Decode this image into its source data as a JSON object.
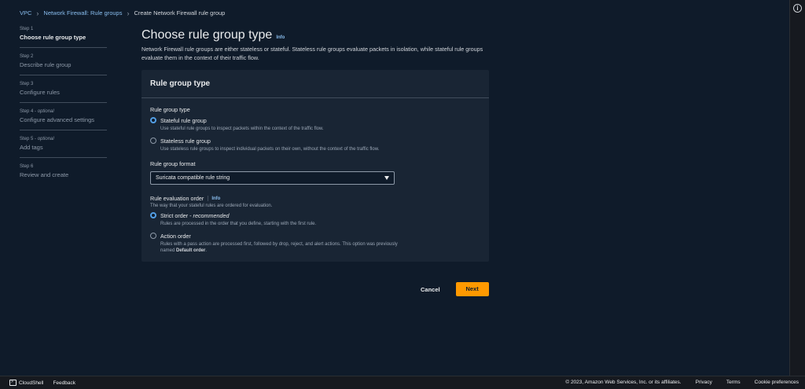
{
  "breadcrumb": {
    "items": [
      "VPC",
      "Network Firewall: Rule groups"
    ],
    "current": "Create Network Firewall rule group"
  },
  "steps": [
    {
      "num": "Step 1",
      "optional": "",
      "title": "Choose rule group type",
      "active": true
    },
    {
      "num": "Step 2",
      "optional": "",
      "title": "Describe rule group",
      "active": false
    },
    {
      "num": "Step 3",
      "optional": "",
      "title": "Configure rules",
      "active": false
    },
    {
      "num": "Step 4 - ",
      "optional": "optional",
      "title": "Configure advanced settings",
      "active": false
    },
    {
      "num": "Step 5 - ",
      "optional": "optional",
      "title": "Add tags",
      "active": false
    },
    {
      "num": "Step 6",
      "optional": "",
      "title": "Review and create",
      "active": false
    }
  ],
  "main": {
    "title": "Choose rule group type",
    "info": "Info",
    "description": "Network Firewall rule groups are either stateless or stateful. Stateless rule groups evaluate packets in isolation, while stateful rule groups evaluate them in the context of their traffic flow."
  },
  "container": {
    "header": "Rule group type",
    "type_label": "Rule group type",
    "type_options": [
      {
        "label": "Stateful rule group",
        "sub": "Use stateful rule groups to inspect packets within the context of the traffic flow.",
        "checked": true
      },
      {
        "label": "Stateless rule group",
        "sub": "Use stateless rule groups to inspect individual packets on their own, without the context of the traffic flow.",
        "checked": false
      }
    ],
    "format_label": "Rule group format",
    "format_value": "Suricata compatible rule string",
    "order_label": "Rule evaluation order",
    "order_info": "Info",
    "order_sub": "The way that your stateful rules are ordered for evaluation.",
    "order_options": [
      {
        "label": "Strict order - ",
        "label_em": "recommended",
        "sub": "Rules are processed in the order that you define, starting with the first rule.",
        "checked": true
      },
      {
        "label": "Action order",
        "label_em": "",
        "sub": "Rules with a pass action are processed first, followed by drop, reject, and alert actions. This option was previously named ",
        "sub_bold": "Default order",
        "sub_end": ".",
        "checked": false
      }
    ]
  },
  "actions": {
    "cancel": "Cancel",
    "next": "Next"
  },
  "footer": {
    "cloudshell": "CloudShell",
    "feedback": "Feedback",
    "copyright": "© 2023, Amazon Web Services, Inc. or its affiliates.",
    "privacy": "Privacy",
    "terms": "Terms",
    "cookies": "Cookie preferences"
  },
  "colors": {
    "accent": "#ff9900",
    "link": "#89bdee",
    "background": "#0f1b2a"
  }
}
